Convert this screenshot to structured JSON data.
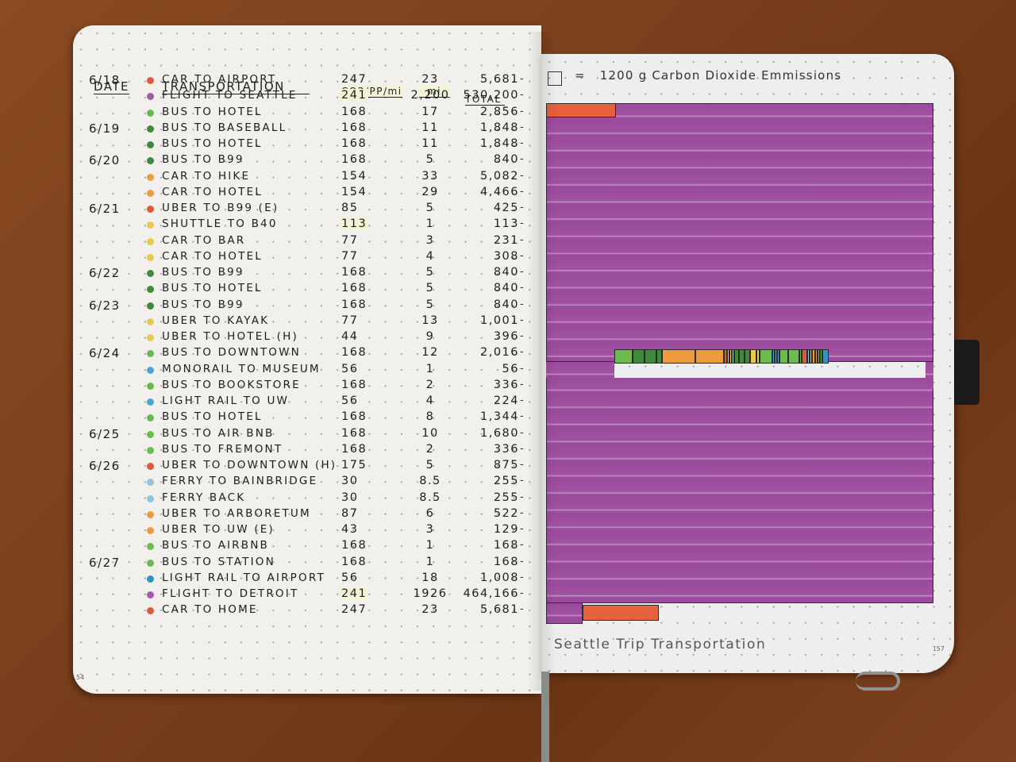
{
  "left_page": {
    "page_number": "54",
    "headers": {
      "date": "DATE",
      "transportation": "TRANSPORTATION",
      "co2_per_person_per_mile": "CO2/PP/mi",
      "miles": "mi",
      "total": "TOTAL"
    },
    "rows": [
      {
        "date": "6/18",
        "label": "CAR TO AIRPORT",
        "color": "#e0583a",
        "co2": "247",
        "mi": "23",
        "total": "5,681"
      },
      {
        "date": "",
        "label": "FLIGHT TO SEATTLE",
        "color": "#a45aa6",
        "co2": "241",
        "mi": "2,200",
        "total": "530,200"
      },
      {
        "date": "",
        "label": "BUS TO HOTEL",
        "color": "#6dbb4f",
        "co2": "168",
        "mi": "17",
        "total": "2,856"
      },
      {
        "date": "6/19",
        "label": "BUS TO BASEBALL",
        "color": "#3f8a3a",
        "co2": "168",
        "mi": "11",
        "total": "1,848"
      },
      {
        "date": "",
        "label": "BUS TO HOTEL",
        "color": "#3f8a3a",
        "co2": "168",
        "mi": "11",
        "total": "1,848"
      },
      {
        "date": "6/20",
        "label": "BUS TO B99",
        "color": "#3f8a3a",
        "co2": "168",
        "mi": "5",
        "total": "840"
      },
      {
        "date": "",
        "label": "CAR TO HIKE",
        "color": "#ee9a3f",
        "co2": "154",
        "mi": "33",
        "total": "5,082"
      },
      {
        "date": "",
        "label": "CAR TO HOTEL",
        "color": "#ee9a3f",
        "co2": "154",
        "mi": "29",
        "total": "4,466"
      },
      {
        "date": "6/21",
        "label": "UBER TO B99 (E)",
        "color": "#e0583a",
        "co2": "85",
        "mi": "5",
        "total": "425"
      },
      {
        "date": "",
        "label": "SHUTTLE TO B40",
        "color": "#ecc94a",
        "co2": "113",
        "mi": "1",
        "total": "113"
      },
      {
        "date": "",
        "label": "CAR TO BAR",
        "color": "#ecc94a",
        "co2": "77",
        "mi": "3",
        "total": "231"
      },
      {
        "date": "",
        "label": "CAR TO HOTEL",
        "color": "#ecc94a",
        "co2": "77",
        "mi": "4",
        "total": "308"
      },
      {
        "date": "6/22",
        "label": "BUS TO B99",
        "color": "#3f8a3a",
        "co2": "168",
        "mi": "5",
        "total": "840"
      },
      {
        "date": "",
        "label": "BUS TO HOTEL",
        "color": "#3f8a3a",
        "co2": "168",
        "mi": "5",
        "total": "840"
      },
      {
        "date": "6/23",
        "label": "BUS TO B99",
        "color": "#3f8a3a",
        "co2": "168",
        "mi": "5",
        "total": "840"
      },
      {
        "date": "",
        "label": "UBER TO KAYAK",
        "color": "#ecc94a",
        "co2": "77",
        "mi": "13",
        "total": "1,001"
      },
      {
        "date": "",
        "label": "UBER TO HOTEL (H)",
        "color": "#ecc94a",
        "co2": "44",
        "mi": "9",
        "total": "396"
      },
      {
        "date": "6/24",
        "label": "BUS TO DOWNTOWN",
        "color": "#6dbb4f",
        "co2": "168",
        "mi": "12",
        "total": "2,016"
      },
      {
        "date": "",
        "label": "MONORAIL TO MUSEUM",
        "color": "#4aa6d2",
        "co2": "56",
        "mi": "1",
        "total": "56"
      },
      {
        "date": "",
        "label": "BUS TO BOOKSTORE",
        "color": "#6dbb4f",
        "co2": "168",
        "mi": "2",
        "total": "336"
      },
      {
        "date": "",
        "label": "LIGHT RAIL TO UW",
        "color": "#4aa6d2",
        "co2": "56",
        "mi": "4",
        "total": "224"
      },
      {
        "date": "",
        "label": "BUS TO HOTEL",
        "color": "#6dbb4f",
        "co2": "168",
        "mi": "8",
        "total": "1,344"
      },
      {
        "date": "6/25",
        "label": "BUS TO AIR BNB",
        "color": "#6dbb4f",
        "co2": "168",
        "mi": "10",
        "total": "1,680"
      },
      {
        "date": "",
        "label": "BUS TO FREMONT",
        "color": "#6dbb4f",
        "co2": "168",
        "mi": "2",
        "total": "336"
      },
      {
        "date": "6/26",
        "label": "UBER TO DOWNTOWN (H)",
        "color": "#e0583a",
        "co2": "175",
        "mi": "5",
        "total": "875"
      },
      {
        "date": "",
        "label": "FERRY TO BAINBRIDGE",
        "color": "#8fc4e6",
        "co2": "30",
        "mi": "8.5",
        "total": "255"
      },
      {
        "date": "",
        "label": "FERRY BACK",
        "color": "#8fc4e6",
        "co2": "30",
        "mi": "8.5",
        "total": "255"
      },
      {
        "date": "",
        "label": "UBER TO ARBORETUM",
        "color": "#ee9a3f",
        "co2": "87",
        "mi": "6",
        "total": "522"
      },
      {
        "date": "",
        "label": "UBER TO UW (E)",
        "color": "#ee9a3f",
        "co2": "43",
        "mi": "3",
        "total": "129"
      },
      {
        "date": "",
        "label": "BUS TO AIRBNB",
        "color": "#6dbb4f",
        "co2": "168",
        "mi": "1",
        "total": "168"
      },
      {
        "date": "6/27",
        "label": "BUS TO STATION",
        "color": "#6dbb4f",
        "co2": "168",
        "mi": "1",
        "total": "168"
      },
      {
        "date": "",
        "label": "LIGHT RAIL TO AIRPORT",
        "color": "#2f93c4",
        "co2": "56",
        "mi": "18",
        "total": "1,008"
      },
      {
        "date": "",
        "label": "FLIGHT TO DETROIT",
        "color": "#a45aa6",
        "co2": "241",
        "mi": "1926",
        "total": "464,166"
      },
      {
        "date": "",
        "label": "CAR TO HOME",
        "color": "#e0583a",
        "co2": "247",
        "mi": "23",
        "total": "5,681"
      }
    ],
    "highlighted_co2_rows": [
      1,
      9,
      32
    ]
  },
  "right_page": {
    "page_number": "157",
    "legend": {
      "equals": "=",
      "text": "1200 g  Carbon Dioxide Emmissions"
    },
    "caption": "Seattle Trip Transportation",
    "colors": {
      "purple": "#9b4b9c",
      "orange_red": "#e0583a"
    }
  }
}
